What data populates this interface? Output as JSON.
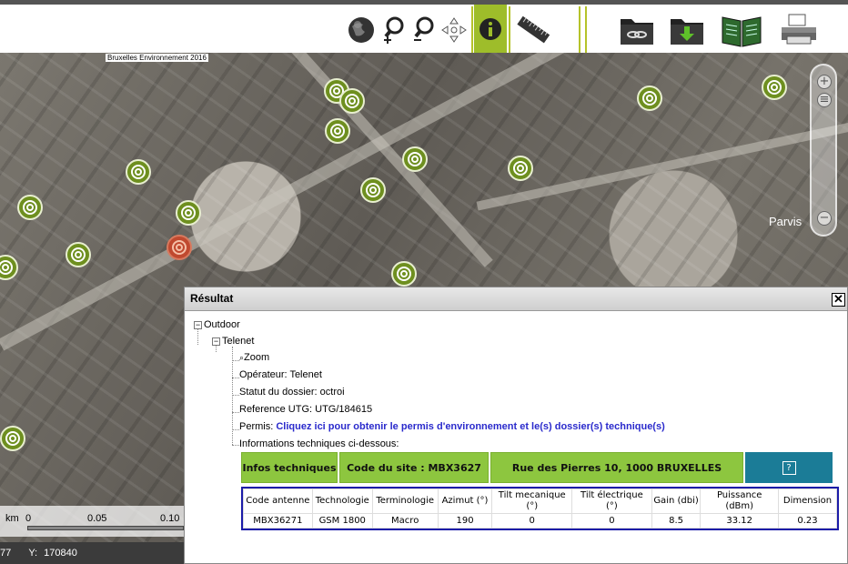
{
  "toolbar": {
    "buttons": [
      "globe-icon",
      "zoom-in-icon",
      "zoom-out-icon",
      "pan-icon",
      "info-icon",
      "ruler-icon",
      "link-folder-icon",
      "download-folder-icon",
      "book-icon",
      "printer-icon"
    ]
  },
  "map": {
    "copyright": "Bruxelles Environnement 2016",
    "place_label": "Parvis",
    "scale": {
      "unit": "km",
      "ticks": [
        "0",
        "0.05",
        "0.10"
      ]
    },
    "coords": {
      "x_partial": "77",
      "y_label": "Y:",
      "y_value": "170840"
    }
  },
  "result": {
    "title": "Résultat",
    "close_symbol": "✕",
    "tree": {
      "root": "Outdoor",
      "operator_node": "Telenet",
      "zoom": "Zoom",
      "operateur": "Opérateur: Telenet",
      "statut": "Statut du dossier: octroi",
      "reference": "Reference UTG: UTG/184615",
      "permis_label": "Permis: ",
      "permis_link": "Cliquez ici pour obtenir le permis d'environnement et le(s) dossier(s) technique(s)",
      "info_tech": "Informations techniques ci-dessous:"
    },
    "header_row": {
      "infos": "Infos techniques",
      "site_code": "Code du site : MBX3627",
      "address": "Rue des Pierres 10, 1000 BRUXELLES",
      "help": "?"
    },
    "antenna_table": {
      "columns": [
        "Code antenne",
        "Technologie",
        "Terminologie",
        "Azimut (°)",
        "Tilt mecanique (°)",
        "Tilt électrique (°)",
        "Gain (dbi)",
        "Puissance (dBm)",
        "Dimension"
      ],
      "rows": [
        [
          "MBX36271",
          "GSM 1800",
          "Macro",
          "190",
          "0",
          "0",
          "8.5",
          "33.12",
          "0.23"
        ]
      ]
    }
  }
}
